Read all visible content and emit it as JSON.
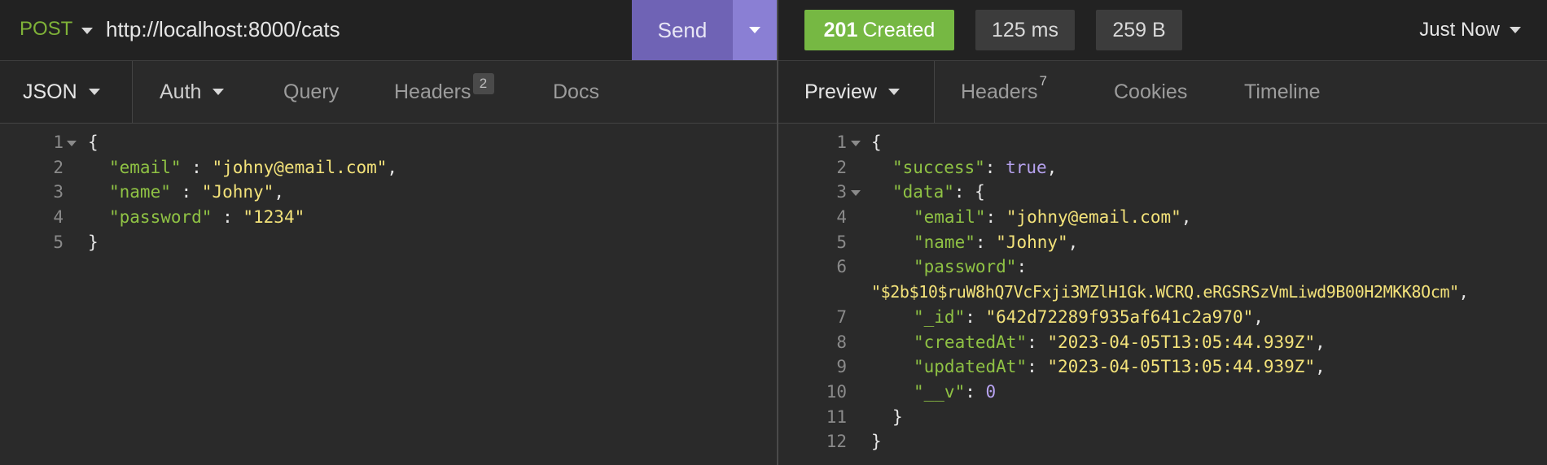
{
  "request": {
    "method": "POST",
    "url": "http://localhost:8000/cats",
    "send_label": "Send",
    "tabs": [
      {
        "label": "JSON"
      },
      {
        "label": "Auth"
      },
      {
        "label": "Query"
      },
      {
        "label": "Headers",
        "count": "2"
      },
      {
        "label": "Docs"
      }
    ],
    "line_numbers": [
      "1",
      "2",
      "3",
      "4",
      "5"
    ],
    "body": {
      "open": "{",
      "email_key": "\"email\"",
      "email_val": "\"johny@email.com\"",
      "name_key": "\"name\"",
      "name_val": "\"Johny\"",
      "password_key": "\"password\"",
      "password_val": "\"1234\"",
      "close": "}"
    }
  },
  "response": {
    "status_code": "201",
    "status_text": "Created",
    "time": "125 ms",
    "size": "259 B",
    "history": "Just Now",
    "tabs": [
      {
        "label": "Preview"
      },
      {
        "label": "Headers",
        "count": "7"
      },
      {
        "label": "Cookies"
      },
      {
        "label": "Timeline"
      }
    ],
    "line_numbers": [
      "1",
      "2",
      "3",
      "4",
      "5",
      "6",
      "7",
      "8",
      "9",
      "10",
      "11",
      "12"
    ],
    "body": {
      "success_key": "\"success\"",
      "success_val": "true",
      "data_key": "\"data\"",
      "email_key": "\"email\"",
      "email_val": "\"johny@email.com\"",
      "name_key": "\"name\"",
      "name_val": "\"Johny\"",
      "password_key": "\"password\"",
      "password_val": "\"$2b$10$ruW8hQ7VcFxji3MZlH1Gk.WCRQ.eRGSRSzVmLiwd9B00H2MKK8Ocm\"",
      "id_key": "\"_id\"",
      "id_val": "\"642d72289f935af641c2a970\"",
      "created_key": "\"createdAt\"",
      "created_val": "\"2023-04-05T13:05:44.939Z\"",
      "updated_key": "\"updatedAt\"",
      "updated_val": "\"2023-04-05T13:05:44.939Z\"",
      "v_key": "\"__v\"",
      "v_val": "0"
    }
  },
  "colors": {
    "method": "#7fb238",
    "send": "#6f63b5",
    "status_success": "#76b843",
    "json_key": "#8fc244",
    "json_string": "#f3e27a",
    "json_literal": "#b7a3f0"
  },
  "icons": [
    "chevron-down-icon",
    "fold-arrow-icon"
  ]
}
